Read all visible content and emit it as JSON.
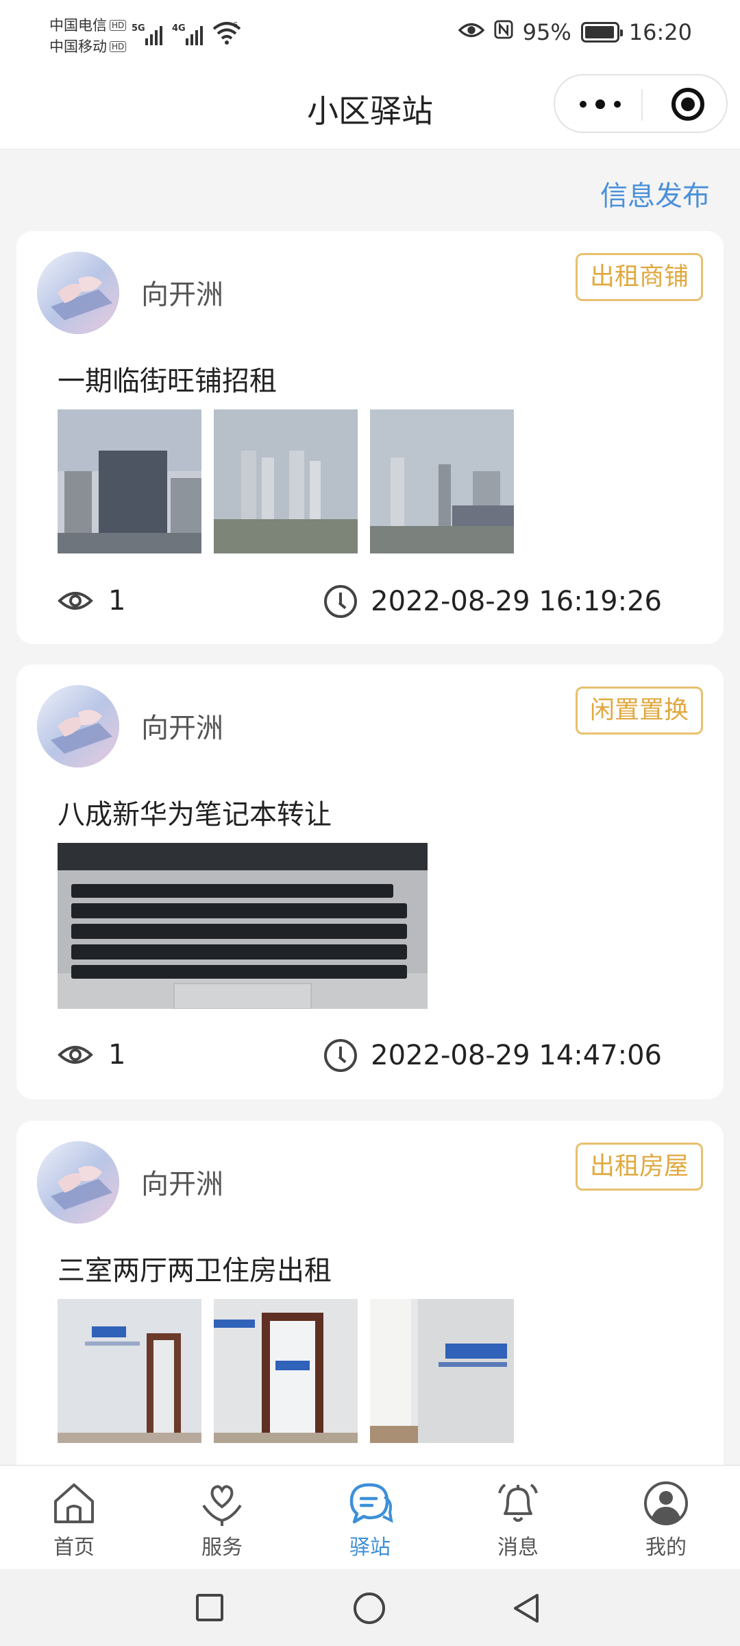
{
  "status_bar": {
    "carrier1": "中国电信",
    "carrier2": "中国移动",
    "hd": "HD",
    "net1": "5G",
    "net2": "4G",
    "wifi_tag": "6",
    "battery": "95%",
    "time": "16:20"
  },
  "nav": {
    "title": "小区驿站"
  },
  "publish_label": "信息发布",
  "posts": [
    {
      "author": "向开洲",
      "tag": "出租商铺",
      "title": "一期临街旺铺招租",
      "views": "1",
      "time": "2022-08-29 16:19:26"
    },
    {
      "author": "向开洲",
      "tag": "闲置置换",
      "title": "八成新华为笔记本转让",
      "views": "1",
      "time": "2022-08-29 14:47:06"
    },
    {
      "author": "向开洲",
      "tag": "出租房屋",
      "title": "三室两厅两卫住房出租",
      "views": "",
      "time": ""
    }
  ],
  "tabs": [
    {
      "label": "首页",
      "icon": "home-icon"
    },
    {
      "label": "服务",
      "icon": "heart-hand-icon"
    },
    {
      "label": "驿站",
      "icon": "chat-bubble-icon"
    },
    {
      "label": "消息",
      "icon": "bell-icon"
    },
    {
      "label": "我的",
      "icon": "user-icon"
    }
  ],
  "active_tab": "驿站",
  "colors": {
    "accent": "#3d8fd8",
    "tag": "#e0a93f",
    "link": "#4a90d9"
  }
}
